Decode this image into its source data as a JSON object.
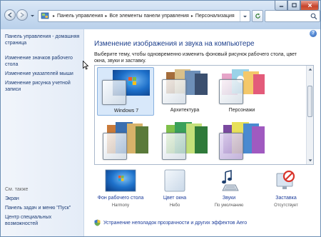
{
  "address": {
    "crumbs": [
      "Панель управления",
      "Все элементы панели управления",
      "Персонализация"
    ]
  },
  "left_pane": {
    "home_link": "Панель управления - домашняя страница",
    "links": [
      "Изменение значков рабочего стола",
      "Изменение указателей мыши",
      "Изменение рисунка учетной записи"
    ],
    "see_also_title": "См. также",
    "see_also": [
      "Экран",
      "Панель задач и меню \"Пуск\"",
      "Центр специальных возможностей"
    ]
  },
  "main": {
    "title": "Изменение изображения и звука на компьютере",
    "description": "Выберите тему, чтобы одновременно изменить фоновый рисунок рабочего стола, цвет окна, звуки и заставку.",
    "help": "?"
  },
  "themes": [
    {
      "label": "Windows 7",
      "selected": true
    },
    {
      "label": "Архитектура",
      "selected": false
    },
    {
      "label": "Персонажи",
      "selected": false
    }
  ],
  "options": [
    {
      "title": "Фон рабочего стола",
      "value": "Harmony"
    },
    {
      "title": "Цвет окна",
      "value": "Небо"
    },
    {
      "title": "Звуки",
      "value": "По умолчанию"
    },
    {
      "title": "Заставка",
      "value": "Отсутствует"
    }
  ],
  "troubleshoot_link": "Устранение неполадок прозрачности и других эффектов Aero",
  "colors": {
    "link": "#1b3b9a",
    "selected_theme_bg": "#d8e8fa",
    "titlebar": "#c7daf0"
  }
}
